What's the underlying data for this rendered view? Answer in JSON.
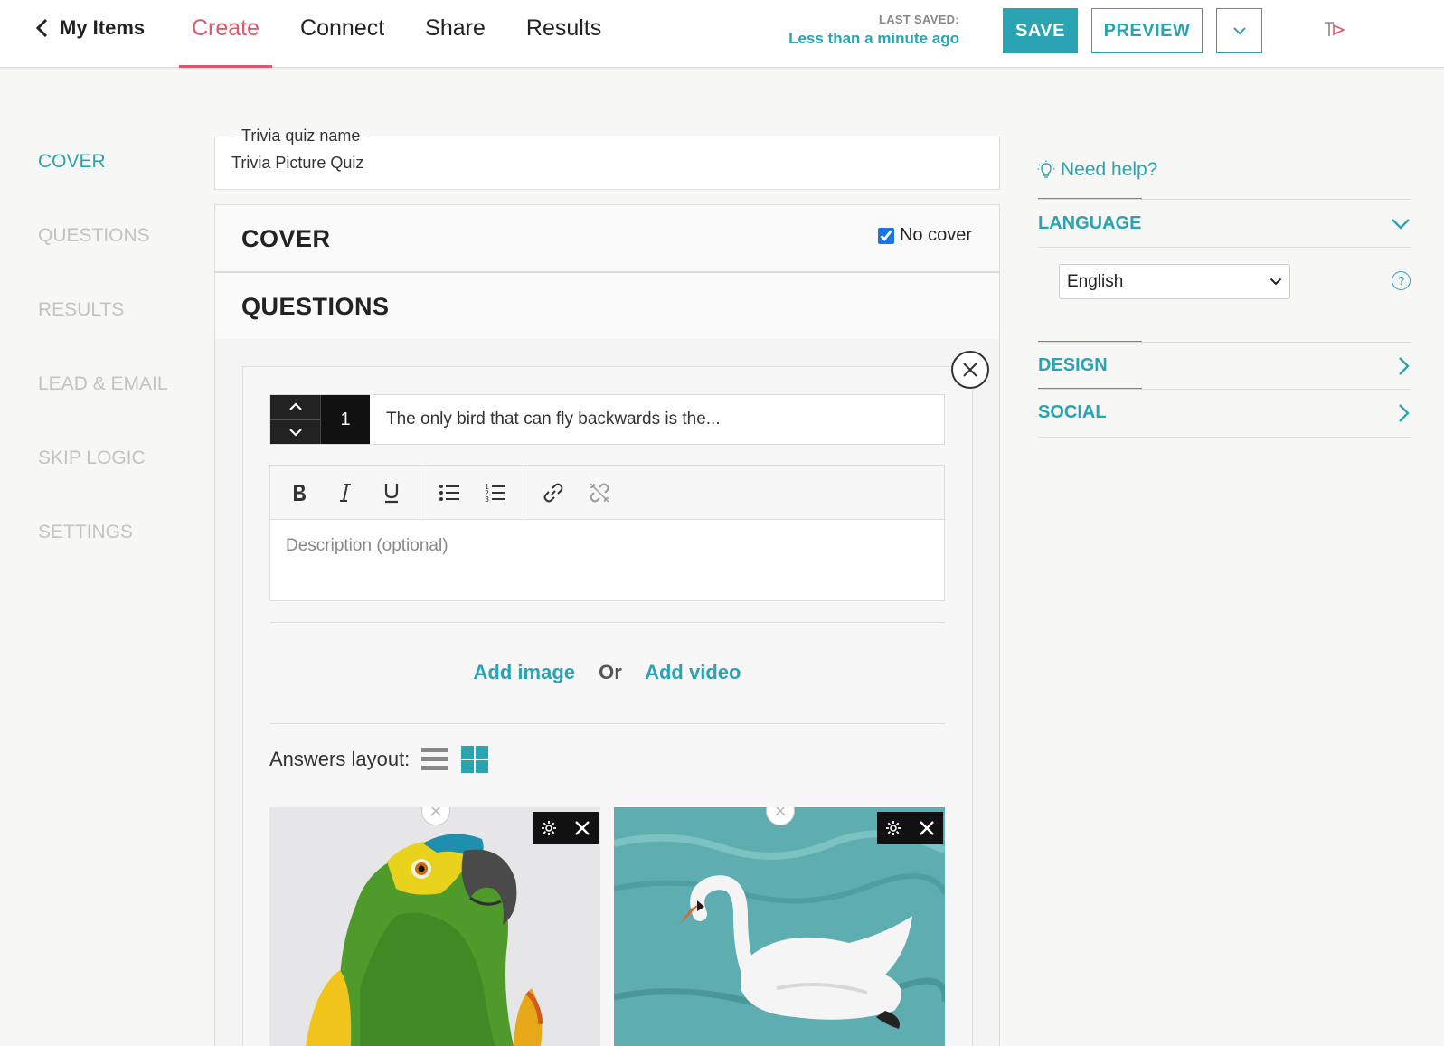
{
  "header": {
    "back_label": "My Items",
    "tabs": [
      {
        "label": "Create",
        "active": true
      },
      {
        "label": "Connect",
        "active": false
      },
      {
        "label": "Share",
        "active": false
      },
      {
        "label": "Results",
        "active": false
      }
    ],
    "last_saved_label": "LAST SAVED:",
    "last_saved_value": "Less than a minute ago",
    "save_label": "SAVE",
    "preview_label": "PREVIEW"
  },
  "leftnav": {
    "items": [
      {
        "label": "COVER",
        "active": true
      },
      {
        "label": "QUESTIONS",
        "active": false
      },
      {
        "label": "RESULTS",
        "active": false
      },
      {
        "label": "LEAD & EMAIL",
        "active": false
      },
      {
        "label": "SKIP LOGIC",
        "active": false
      },
      {
        "label": "SETTINGS",
        "active": false
      }
    ]
  },
  "main": {
    "name_field": {
      "label": "Trivia quiz name",
      "value": "Trivia Picture Quiz"
    },
    "cover_title": "COVER",
    "no_cover_label": "No cover",
    "no_cover_checked": true,
    "questions_title": "QUESTIONS",
    "question": {
      "number": "1",
      "text": "The only bird that can fly backwards is the...",
      "description_placeholder": "Description (optional)",
      "add_image": "Add image",
      "or": "Or",
      "add_video": "Add video",
      "answers_layout_label": "Answers layout:"
    }
  },
  "sidebar": {
    "help_label": "Need help?",
    "language_title": "LANGUAGE",
    "language_value": "English",
    "design_title": "DESIGN",
    "social_title": "SOCIAL"
  },
  "colors": {
    "accent": "#2aa3b3",
    "active_tab": "#e0566a"
  }
}
